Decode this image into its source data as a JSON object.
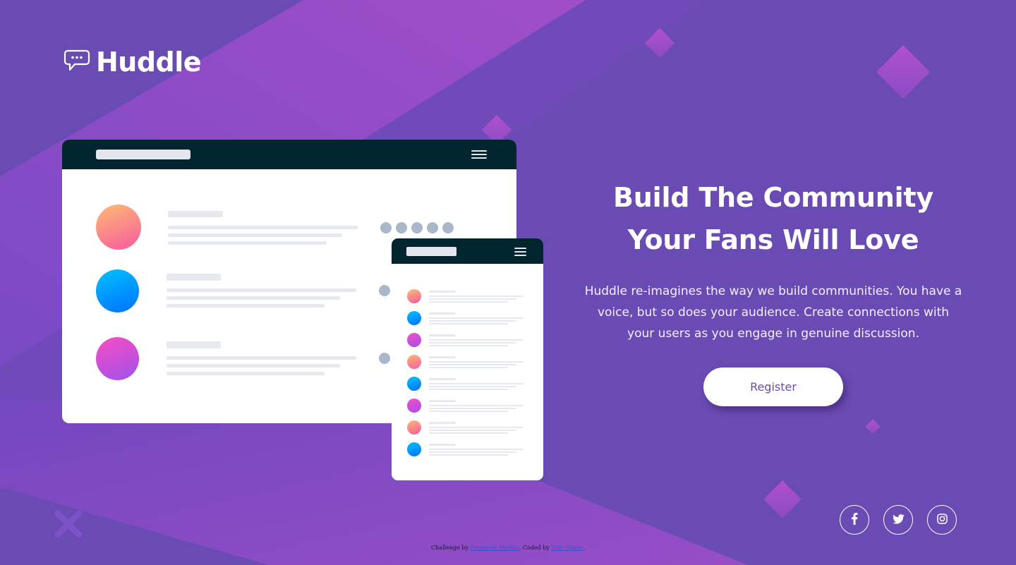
{
  "brand": {
    "name": "Huddle",
    "accent_color": "#6a4bb3",
    "logo_icon": "chat-bubble-icon"
  },
  "hero": {
    "title_line1": "Build The Community",
    "title_line2": "Your Fans Will Love",
    "description": "Huddle re-imagines the way we build communities. You have a voice, but so does your audience. Create connections with your users as you engage in genuine discussion.",
    "cta_label": "Register"
  },
  "social": [
    {
      "name": "facebook",
      "icon": "facebook-icon"
    },
    {
      "name": "twitter",
      "icon": "twitter-icon"
    },
    {
      "name": "instagram",
      "icon": "instagram-icon"
    }
  ],
  "attribution": {
    "prefix": "Challenge by ",
    "challenge_link": "Frontend Mentor",
    "middle": ". Coded by ",
    "author_link": "Your Name",
    "suffix": "."
  },
  "colors": {
    "background": "#6a4bb3",
    "mockup_bar": "#00252e",
    "button_text": "#6a4bb3"
  }
}
